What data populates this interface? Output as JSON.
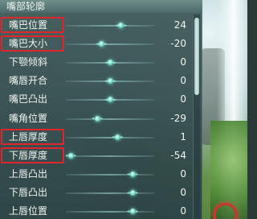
{
  "panel": {
    "title": "嘴部轮廓"
  },
  "sliders": [
    {
      "label": "嘴巴位置",
      "value": "24",
      "level": 0.62,
      "highlighted": true
    },
    {
      "label": "嘴巴大小",
      "value": "-20",
      "level": 0.4,
      "highlighted": true
    },
    {
      "label": "下颚倾斜",
      "value": "0",
      "level": 0.5,
      "highlighted": false
    },
    {
      "label": "嘴唇开合",
      "value": "0",
      "level": 0.5,
      "highlighted": false
    },
    {
      "label": "嘴巴凸出",
      "value": "0",
      "level": 0.5,
      "highlighted": false
    },
    {
      "label": "嘴角位置",
      "value": "-29",
      "level": 0.35,
      "highlighted": false
    },
    {
      "label": "上唇厚度",
      "value": "1",
      "level": 0.58,
      "highlighted": true
    },
    {
      "label": "下唇厚度",
      "value": "-54",
      "level": 0.05,
      "highlighted": true
    },
    {
      "label": "上唇凸出",
      "value": "0",
      "level": 0.75,
      "highlighted": false
    },
    {
      "label": "下唇凸出",
      "value": "0",
      "level": 0.75,
      "highlighted": false
    },
    {
      "label": "上唇位置",
      "value": "0",
      "level": 0.75,
      "highlighted": false
    }
  ],
  "colors": {
    "highlight_border": "#e0262a",
    "thumb_glow": "#7ff0dc"
  },
  "icons": {
    "slider_thumb": "glowing-orb-icon",
    "scene_marker": "red-ring-icon"
  }
}
